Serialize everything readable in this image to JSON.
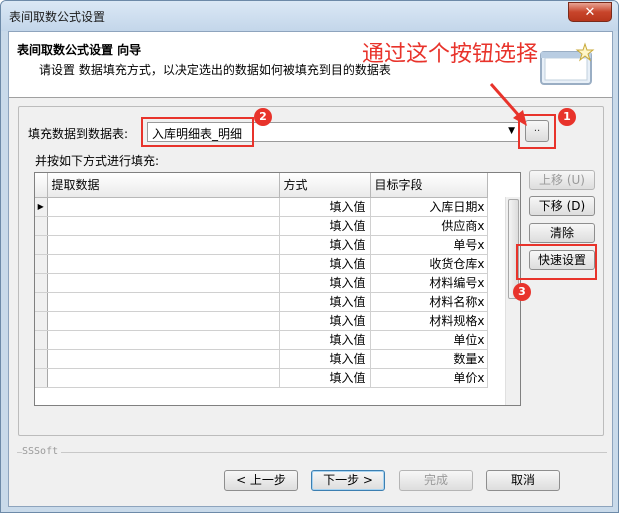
{
  "window": {
    "title": "表间取数公式设置",
    "close_icon": "close-icon"
  },
  "header": {
    "title": "表间取数公式设置 向导",
    "description": "请设置 数据填充方式，以决定选出的数据如何被填充到目的数据表"
  },
  "annotation": {
    "text": "通过这个按钮选择",
    "color": "#e8332b",
    "badges": [
      "1",
      "2",
      "3"
    ]
  },
  "fill_target": {
    "label": "填充数据到数据表:",
    "value": "入库明细表_明细",
    "browse_label": ".."
  },
  "grid": {
    "caption": "并按如下方式进行填充:",
    "columns": [
      "提取数据",
      "方式",
      "目标字段"
    ],
    "rows": [
      {
        "source": "",
        "mode": "填入值",
        "target": "入库日期x"
      },
      {
        "source": "",
        "mode": "填入值",
        "target": "供应商x"
      },
      {
        "source": "",
        "mode": "填入值",
        "target": "单号x"
      },
      {
        "source": "",
        "mode": "填入值",
        "target": "收货仓库x"
      },
      {
        "source": "",
        "mode": "填入值",
        "target": "材料编号x"
      },
      {
        "source": "",
        "mode": "填入值",
        "target": "材料名称x"
      },
      {
        "source": "",
        "mode": "填入值",
        "target": "材料规格x"
      },
      {
        "source": "",
        "mode": "填入值",
        "target": "单位x"
      },
      {
        "source": "",
        "mode": "填入值",
        "target": "数量x"
      },
      {
        "source": "",
        "mode": "填入值",
        "target": "单价x"
      }
    ]
  },
  "side_buttons": {
    "move_up": "上移 (U)",
    "move_down": "下移 (D)",
    "clear": "清除",
    "quick_setup": "快速设置"
  },
  "footer": {
    "brand": "SSSoft",
    "prev": "< 上一步",
    "next": "下一步 >",
    "finish": "完成",
    "cancel": "取消"
  }
}
